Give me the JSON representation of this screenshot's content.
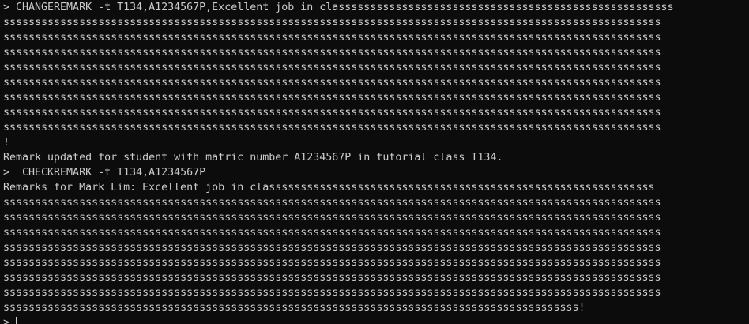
{
  "terminal": {
    "lines": [
      "> CHANGEREMARK -t T134,A1234567P,Excellent job in classsssssssssssssssssssssssssssssssssssssssssssssssssss",
      "ssssssssssssssssssssssssssssssssssssssssssssssssssssssssssssssssssssssssssssssssssssssssssssssssssssssss",
      "ssssssssssssssssssssssssssssssssssssssssssssssssssssssssssssssssssssssssssssssssssssssssssssssssssssssss",
      "ssssssssssssssssssssssssssssssssssssssssssssssssssssssssssssssssssssssssssssssssssssssssssssssssssssssss",
      "ssssssssssssssssssssssssssssssssssssssssssssssssssssssssssssssssssssssssssssssssssssssssssssssssssssssss",
      "ssssssssssssssssssssssssssssssssssssssssssssssssssssssssssssssssssssssssssssssssssssssssssssssssssssssss",
      "ssssssssssssssssssssssssssssssssssssssssssssssssssssssssssssssssssssssssssssssssssssssssssssssssssssssss",
      "ssssssssssssssssssssssssssssssssssssssssssssssssssssssssssssssssssssssssssssssssssssssssssssssssssssssss",
      "ssssssssssssssssssssssssssssssssssssssssssssssssssssssssssssssssssssssssssssssssssssssssssssssssssssssss",
      "!",
      "Remark updated for student with matric number A1234567P in tutorial class T134.",
      ">  CHECKREMARK -t T134,A1234567P",
      "Remarks for Mark Lim: Excellent job in classsssssssssssssssssssssssssssssssssssssssssssssssssssssssssss",
      "ssssssssssssssssssssssssssssssssssssssssssssssssssssssssssssssssssssssssssssssssssssssssssssssssssssssss",
      "ssssssssssssssssssssssssssssssssssssssssssssssssssssssssssssssssssssssssssssssssssssssssssssssssssssssss",
      "ssssssssssssssssssssssssssssssssssssssssssssssssssssssssssssssssssssssssssssssssssssssssssssssssssssssss",
      "ssssssssssssssssssssssssssssssssssssssssssssssssssssssssssssssssssssssssssssssssssssssssssssssssssssssss",
      "ssssssssssssssssssssssssssssssssssssssssssssssssssssssssssssssssssssssssssssssssssssssssssssssssssssssss",
      "ssssssssssssssssssssssssssssssssssssssssssssssssssssssssssssssssssssssssssssssssssssssssssssssssssssssss",
      "ssssssssssssssssssssssssssssssssssssssssssssssssssssssssssssssssssssssssssssssssssssssssssssssssssssssss",
      "sssssssssssssssssssssssssssssssssssssssssssssssssssssssssssssssssssssssssssssssssssssssssss!"
    ],
    "prompt": ">",
    "colors": {
      "background": "#0c0c0c",
      "foreground": "#cccccc"
    }
  }
}
